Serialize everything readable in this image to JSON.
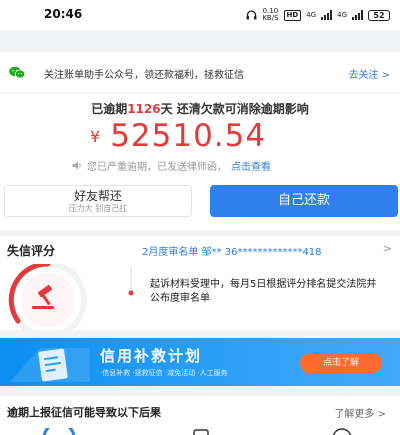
{
  "status_bar": {
    "time": "20:46",
    "speed_value": "0.10",
    "speed_unit": "KB/S",
    "hd_label": "HD",
    "net1": "4G",
    "net2": "4G",
    "battery": "52"
  },
  "notice": {
    "text": "关注账单助手公众号，领还款福利，拯救征信",
    "action": "去关注 >"
  },
  "overdue": {
    "prefix": "已逾期",
    "days": "1126",
    "suffix": "天 还清欠款可消除逾期影响",
    "currency": "¥",
    "amount": "52510.54",
    "warning": "您已严重逾期，已发送律师函，",
    "warning_link": "点击查看"
  },
  "buttons": {
    "friend_title": "好友帮还",
    "friend_sub": "压力大 别自己扛",
    "self_pay": "自己还款"
  },
  "credit": {
    "title": "失信评分",
    "list_info": "2月度审名单 邹** 36*************418",
    "arrow": ">",
    "description": "起诉材料受理中，每月5日根据评分排名提交法院并公布度审名单"
  },
  "banner": {
    "title": "信用补救计划",
    "subtitle": "·信息补救 ·拯救征信 ·减免活动 ·人工服务",
    "button": "点击了解"
  },
  "consequence": {
    "title": "逾期上报征信可能导致以下后果",
    "more": "了解更多 >"
  },
  "colors": {
    "accent_blue": "#2f80ed",
    "alert_red": "#e23b3b",
    "banner_orange": "#ff6b32"
  }
}
